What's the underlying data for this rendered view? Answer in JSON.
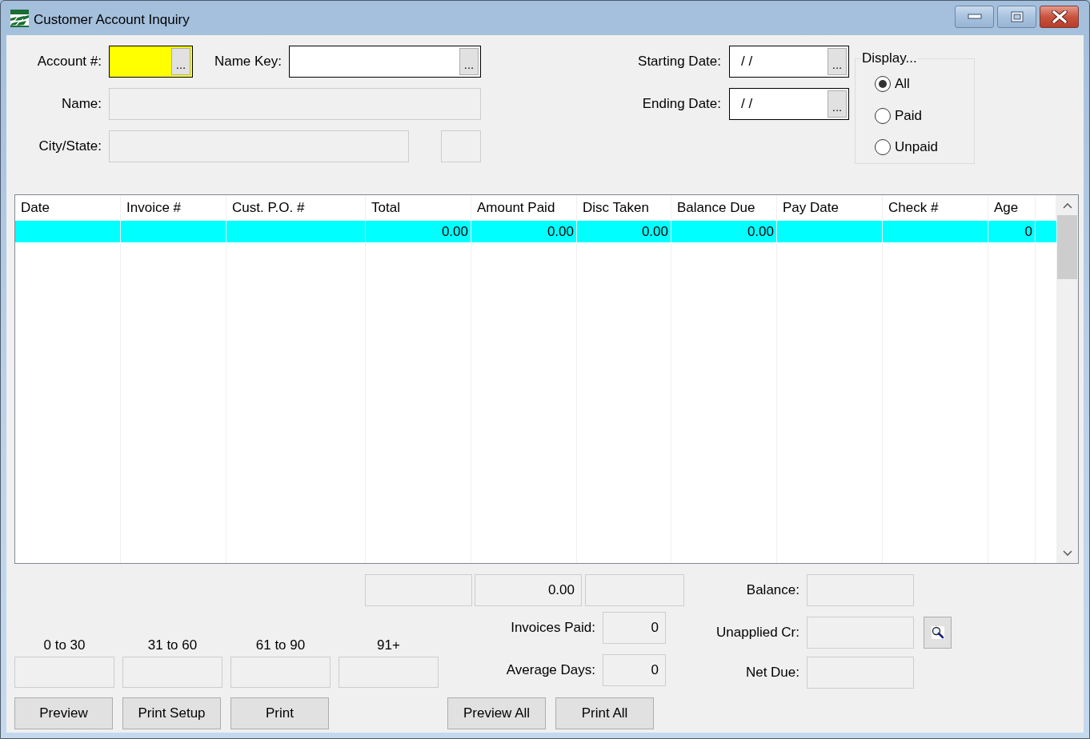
{
  "window": {
    "title": "Customer Account Inquiry"
  },
  "account_rows": [
    [
      {
        "label": "Account #:",
        "kind": "lookup",
        "highlighted": true,
        "button": "..."
      },
      {
        "label": "Name Key:",
        "kind": "lookup",
        "highlighted": false,
        "button": "..."
      }
    ],
    [
      {
        "label": "Name:",
        "kind": "readonly"
      }
    ],
    [
      {
        "label": "City/State:",
        "kind": "split"
      }
    ]
  ],
  "date_fields": [
    {
      "label": "Starting Date:",
      "value": "/ /",
      "button": "..."
    },
    {
      "label": "Ending Date:",
      "value": "/ /",
      "button": "..."
    }
  ],
  "display": {
    "title": "Display...",
    "options": [
      {
        "label": "All",
        "selected": true
      },
      {
        "label": "Paid",
        "selected": false
      },
      {
        "label": "Unpaid",
        "selected": false
      }
    ]
  },
  "table": {
    "columns": [
      {
        "label": "Date",
        "kind": "text"
      },
      {
        "label": "Invoice #",
        "kind": "text"
      },
      {
        "label": "Cust. P.O. #",
        "kind": "text"
      },
      {
        "label": "Total",
        "kind": "number"
      },
      {
        "label": "Amount Paid",
        "kind": "number"
      },
      {
        "label": "Disc Taken",
        "kind": "number"
      },
      {
        "label": "Balance Due",
        "kind": "number"
      },
      {
        "label": "Pay Date",
        "kind": "text"
      },
      {
        "label": "Check #",
        "kind": "text"
      },
      {
        "label": "Age",
        "kind": "number"
      }
    ],
    "rows": [
      {
        "selected": true,
        "cells": [
          null,
          null,
          null,
          "0.00",
          "0.00",
          "0.00",
          "0.00",
          null,
          null,
          "0"
        ]
      }
    ]
  },
  "totals": [
    {
      "kind": "blank"
    },
    {
      "kind": "value",
      "value": "0.00"
    },
    {
      "kind": "blank"
    }
  ],
  "balance_fields": [
    {
      "label": "Balance:",
      "lookup": false
    },
    {
      "label": "Unapplied Cr:",
      "lookup": true
    },
    {
      "label": "Net Due:",
      "lookup": false
    }
  ],
  "aging": [
    {
      "label": "0 to 30"
    },
    {
      "label": "31 to 60"
    },
    {
      "label": "61 to 90"
    },
    {
      "label": "91+"
    }
  ],
  "stats": [
    {
      "label": "Invoices Paid:",
      "value": "0"
    },
    {
      "label": "Average Days:",
      "value": "0"
    }
  ],
  "report_buttons": [
    {
      "label": "Preview"
    },
    {
      "label": "Print Setup"
    },
    {
      "label": "Print"
    }
  ],
  "all_buttons": [
    {
      "label": "Preview All"
    },
    {
      "label": "Print All"
    }
  ]
}
